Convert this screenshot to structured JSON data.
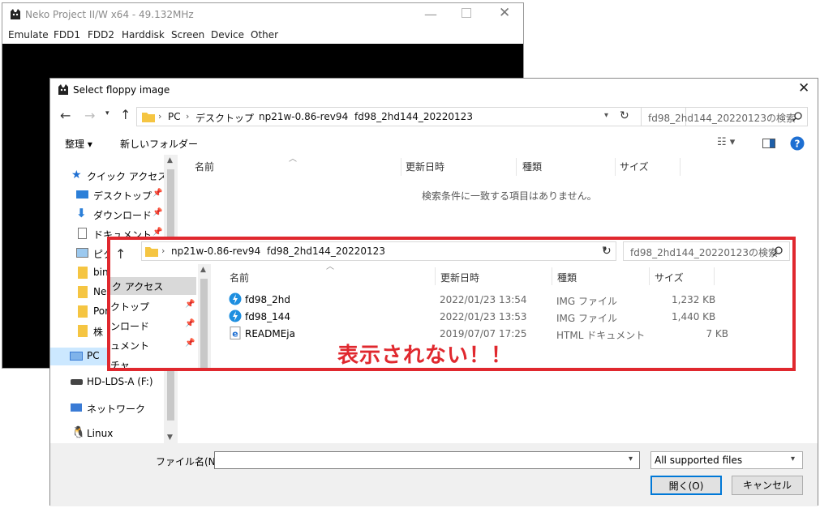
{
  "bg_window": {
    "title": "Neko Project II/W x64 - 49.132MHz",
    "menu": [
      "Emulate",
      "FDD1",
      "FDD2",
      "Harddisk",
      "Screen",
      "Device",
      "Other"
    ]
  },
  "dialog": {
    "title": "Select floppy image",
    "breadcrumb": [
      "PC",
      "デスクトップ",
      "np21w-0.86-rev94",
      "fd98_2hd144_20220123"
    ],
    "search_placeholder": "fd98_2hd144_20220123の検索",
    "toolbar": {
      "organize": "整理 ▾",
      "new_folder": "新しいフォルダー"
    },
    "columns": [
      "名前",
      "更新日時",
      "種類",
      "サイズ"
    ],
    "empty_message": "検索条件に一致する項目はありません。",
    "nav_items": [
      {
        "label": "クイック アクセス",
        "icon": "star-icon"
      },
      {
        "label": "デスクトップ",
        "icon": "desktop-icon",
        "pinned": true
      },
      {
        "label": "ダウンロード",
        "icon": "download-icon",
        "pinned": true
      },
      {
        "label": "ドキュメント",
        "icon": "document-icon",
        "pinned": true
      },
      {
        "label": "ピクチャ",
        "icon": "picture-icon",
        "pinned": true
      },
      {
        "label": "bin",
        "icon": "folder-icon"
      },
      {
        "label": "Ne",
        "icon": "folder-icon"
      },
      {
        "label": "Por",
        "icon": "folder-icon"
      },
      {
        "label": "株",
        "icon": "folder-icon"
      },
      {
        "label": "PC",
        "icon": "pc-icon",
        "selected": true
      },
      {
        "label": "HD-LDS-A (F:)",
        "icon": "drive-icon"
      },
      {
        "label": "ネットワーク",
        "icon": "network-icon"
      },
      {
        "label": "Linux",
        "icon": "linux-icon"
      }
    ],
    "filename_label": "ファイル名(N):",
    "filename_value": "",
    "filter_selected": "All supported files",
    "open_button": "開く(O)",
    "cancel_button": "キャンセル"
  },
  "inset": {
    "breadcrumb": [
      "np21w-0.86-rev94",
      "fd98_2hd144_20220123"
    ],
    "search_placeholder": "fd98_2hd144_20220123の検索",
    "columns": [
      "名前",
      "更新日時",
      "種類",
      "サイズ"
    ],
    "nav_items": [
      "ク アクセス",
      "クトップ",
      "ンロード",
      "ュメント",
      "チャ"
    ],
    "files": [
      {
        "name": "fd98_2hd",
        "date": "2022/01/23 13:54",
        "type": "IMG ファイル",
        "size": "1,232 KB",
        "icon": "img-file-icon"
      },
      {
        "name": "fd98_144",
        "date": "2022/01/23 13:53",
        "type": "IMG ファイル",
        "size": "1,440 KB",
        "icon": "img-file-icon"
      },
      {
        "name": "READMEja",
        "date": "2019/07/07 17:25",
        "type": "HTML ドキュメント",
        "size": "7 KB",
        "icon": "html-file-icon"
      }
    ],
    "annotation": "表示されない！！"
  },
  "colors": {
    "annotation_red": "#e0282e",
    "accent_blue": "#0078d7",
    "folder_yellow": "#f5c542"
  }
}
